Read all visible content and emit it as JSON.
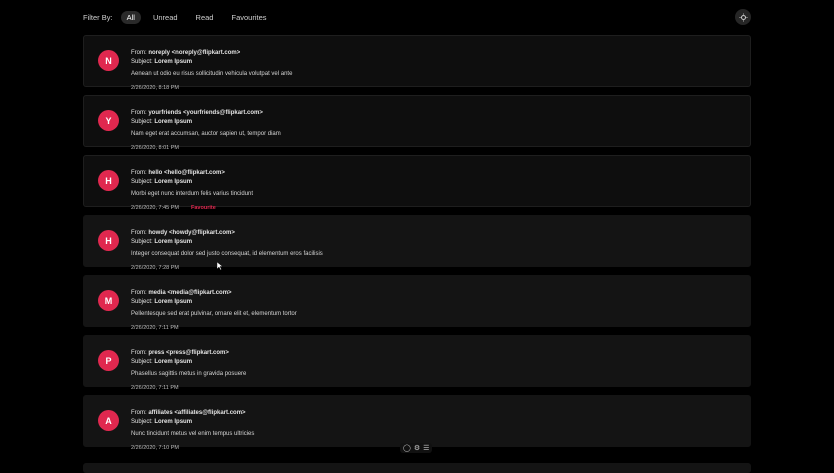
{
  "filter": {
    "label": "Filter By:",
    "options": [
      {
        "label": "All",
        "active": true
      },
      {
        "label": "Unread",
        "active": false
      },
      {
        "label": "Read",
        "active": false
      },
      {
        "label": "Favourites",
        "active": false
      }
    ]
  },
  "emails": [
    {
      "initial": "N",
      "from_prefix": "From:",
      "from": "noreply <noreply@flipkart.com>",
      "subject_prefix": "Subject:",
      "subject": "Lorem Ipsum",
      "body": "Aenean ut odio eu risus sollicitudin vehicula volutpat vel ante",
      "date": "2/26/2020, 8:18 PM",
      "favourite": "",
      "read": false
    },
    {
      "initial": "Y",
      "from_prefix": "From:",
      "from": "yourfriends <yourfriends@flipkart.com>",
      "subject_prefix": "Subject:",
      "subject": "Lorem Ipsum",
      "body": "Nam eget erat accumsan, auctor sapien ut, tempor diam",
      "date": "2/26/2020, 8:01 PM",
      "favourite": "",
      "read": false
    },
    {
      "initial": "H",
      "from_prefix": "From:",
      "from": "hello <hello@flipkart.com>",
      "subject_prefix": "Subject:",
      "subject": "Lorem Ipsum",
      "body": "Morbi eget nunc interdum felis varius tincidunt",
      "date": "2/26/2020, 7:45 PM",
      "favourite": "Favourite",
      "read": false
    },
    {
      "initial": "H",
      "from_prefix": "From:",
      "from": "howdy <howdy@flipkart.com>",
      "subject_prefix": "Subject:",
      "subject": "Lorem Ipsum",
      "body": "Integer consequat dolor sed justo consequat, id elementum eros facilisis",
      "date": "2/26/2020, 7:28 PM",
      "favourite": "",
      "read": true
    },
    {
      "initial": "M",
      "from_prefix": "From:",
      "from": "media <media@flipkart.com>",
      "subject_prefix": "Subject:",
      "subject": "Lorem Ipsum",
      "body": "Pellentesque sed erat pulvinar, ornare elit et, elementum tortor",
      "date": "2/26/2020, 7:11 PM",
      "favourite": "",
      "read": true
    },
    {
      "initial": "P",
      "from_prefix": "From:",
      "from": "press <press@flipkart.com>",
      "subject_prefix": "Subject:",
      "subject": "Lorem Ipsum",
      "body": "Phasellus sagittis metus in gravida posuere",
      "date": "2/26/2020, 7:11 PM",
      "favourite": "",
      "read": true
    },
    {
      "initial": "A",
      "from_prefix": "From:",
      "from": "affiliates <affiliates@flipkart.com>",
      "subject_prefix": "Subject:",
      "subject": "Lorem Ipsum",
      "body": "Nunc tincidunt metus vel enim tempus ultricies",
      "date": "2/26/2020, 7:10 PM",
      "favourite": "",
      "read": true
    }
  ],
  "colors": {
    "accent": "#e0284f",
    "background": "#000000",
    "card": "#141414"
  },
  "icons": {
    "theme_toggle": "theme-toggle-icon",
    "bottom_bar": [
      "chat-icon",
      "settings-icon",
      "menu-icon"
    ]
  }
}
